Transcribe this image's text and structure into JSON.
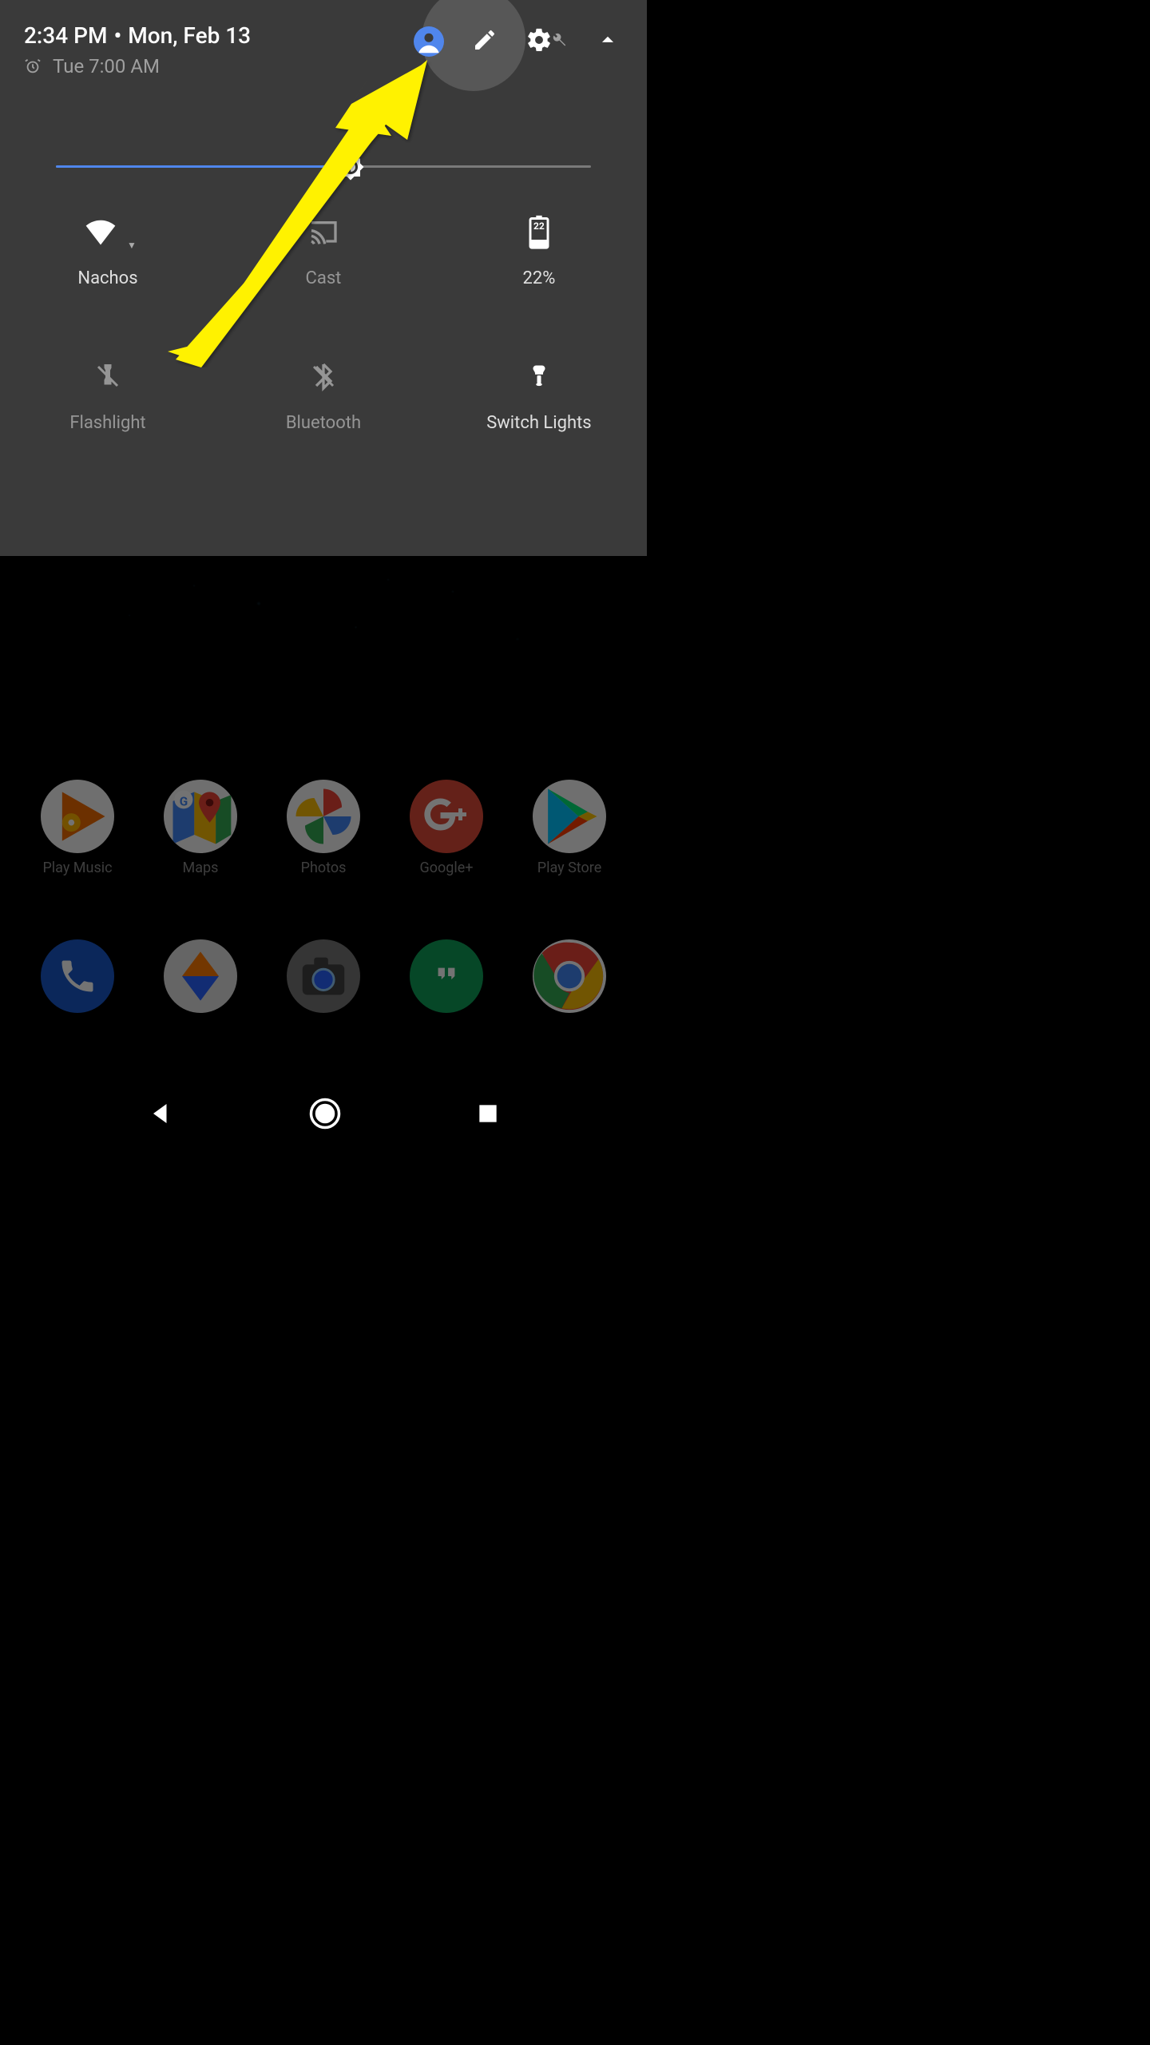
{
  "header": {
    "time": "2:34 PM",
    "separator": "•",
    "date": "Mon, Feb 13",
    "alarm_text": "Tue 7:00 AM"
  },
  "brightness": {
    "percent": 55
  },
  "tiles": [
    {
      "id": "wifi",
      "label": "Nachos",
      "active": true
    },
    {
      "id": "cast",
      "label": "Cast",
      "active": false
    },
    {
      "id": "battery",
      "label": "22%",
      "active": true,
      "battery_value": "22"
    },
    {
      "id": "flashlight",
      "label": "Flashlight",
      "active": false
    },
    {
      "id": "bluetooth",
      "label": "Bluetooth",
      "active": false
    },
    {
      "id": "switchlights",
      "label": "Switch Lights",
      "active": true
    }
  ],
  "apps_row1": [
    {
      "id": "playmusic",
      "label": "Play Music"
    },
    {
      "id": "maps",
      "label": "Maps"
    },
    {
      "id": "photos",
      "label": "Photos"
    },
    {
      "id": "gplus",
      "label": "Google+"
    },
    {
      "id": "playstore",
      "label": "Play Store"
    }
  ],
  "apps_row2": [
    {
      "id": "phone"
    },
    {
      "id": "drive"
    },
    {
      "id": "camera"
    },
    {
      "id": "hangouts"
    },
    {
      "id": "chrome"
    }
  ],
  "colors": {
    "panel_bg": "#3a3a3a",
    "accent": "#4f86ec",
    "annotation": "#fff200"
  }
}
